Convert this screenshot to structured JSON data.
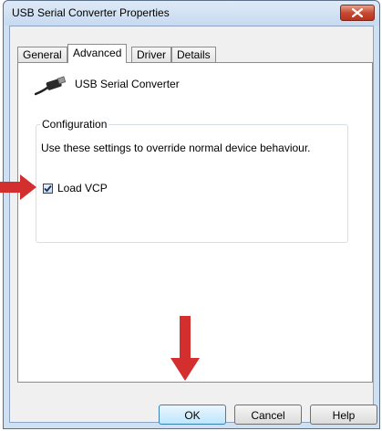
{
  "window": {
    "title": "USB Serial Converter Properties",
    "close_icon": "close-icon"
  },
  "tabs": [
    {
      "label": "General",
      "active": false
    },
    {
      "label": "Advanced",
      "active": true
    },
    {
      "label": "Driver",
      "active": false
    },
    {
      "label": "Details",
      "active": false
    }
  ],
  "device": {
    "icon": "usb-plug-icon",
    "name": "USB Serial Converter"
  },
  "configuration": {
    "legend": "Configuration",
    "description": "Use these settings to override normal device behaviour.",
    "load_vcp": {
      "label": "Load VCP",
      "checked": true
    }
  },
  "buttons": {
    "ok": "OK",
    "cancel": "Cancel",
    "help": "Help"
  },
  "annotations": {
    "arrow_color": "#d32f2f",
    "left_arrow_icon": "arrow-right-icon",
    "down_arrow_icon": "arrow-down-icon"
  }
}
